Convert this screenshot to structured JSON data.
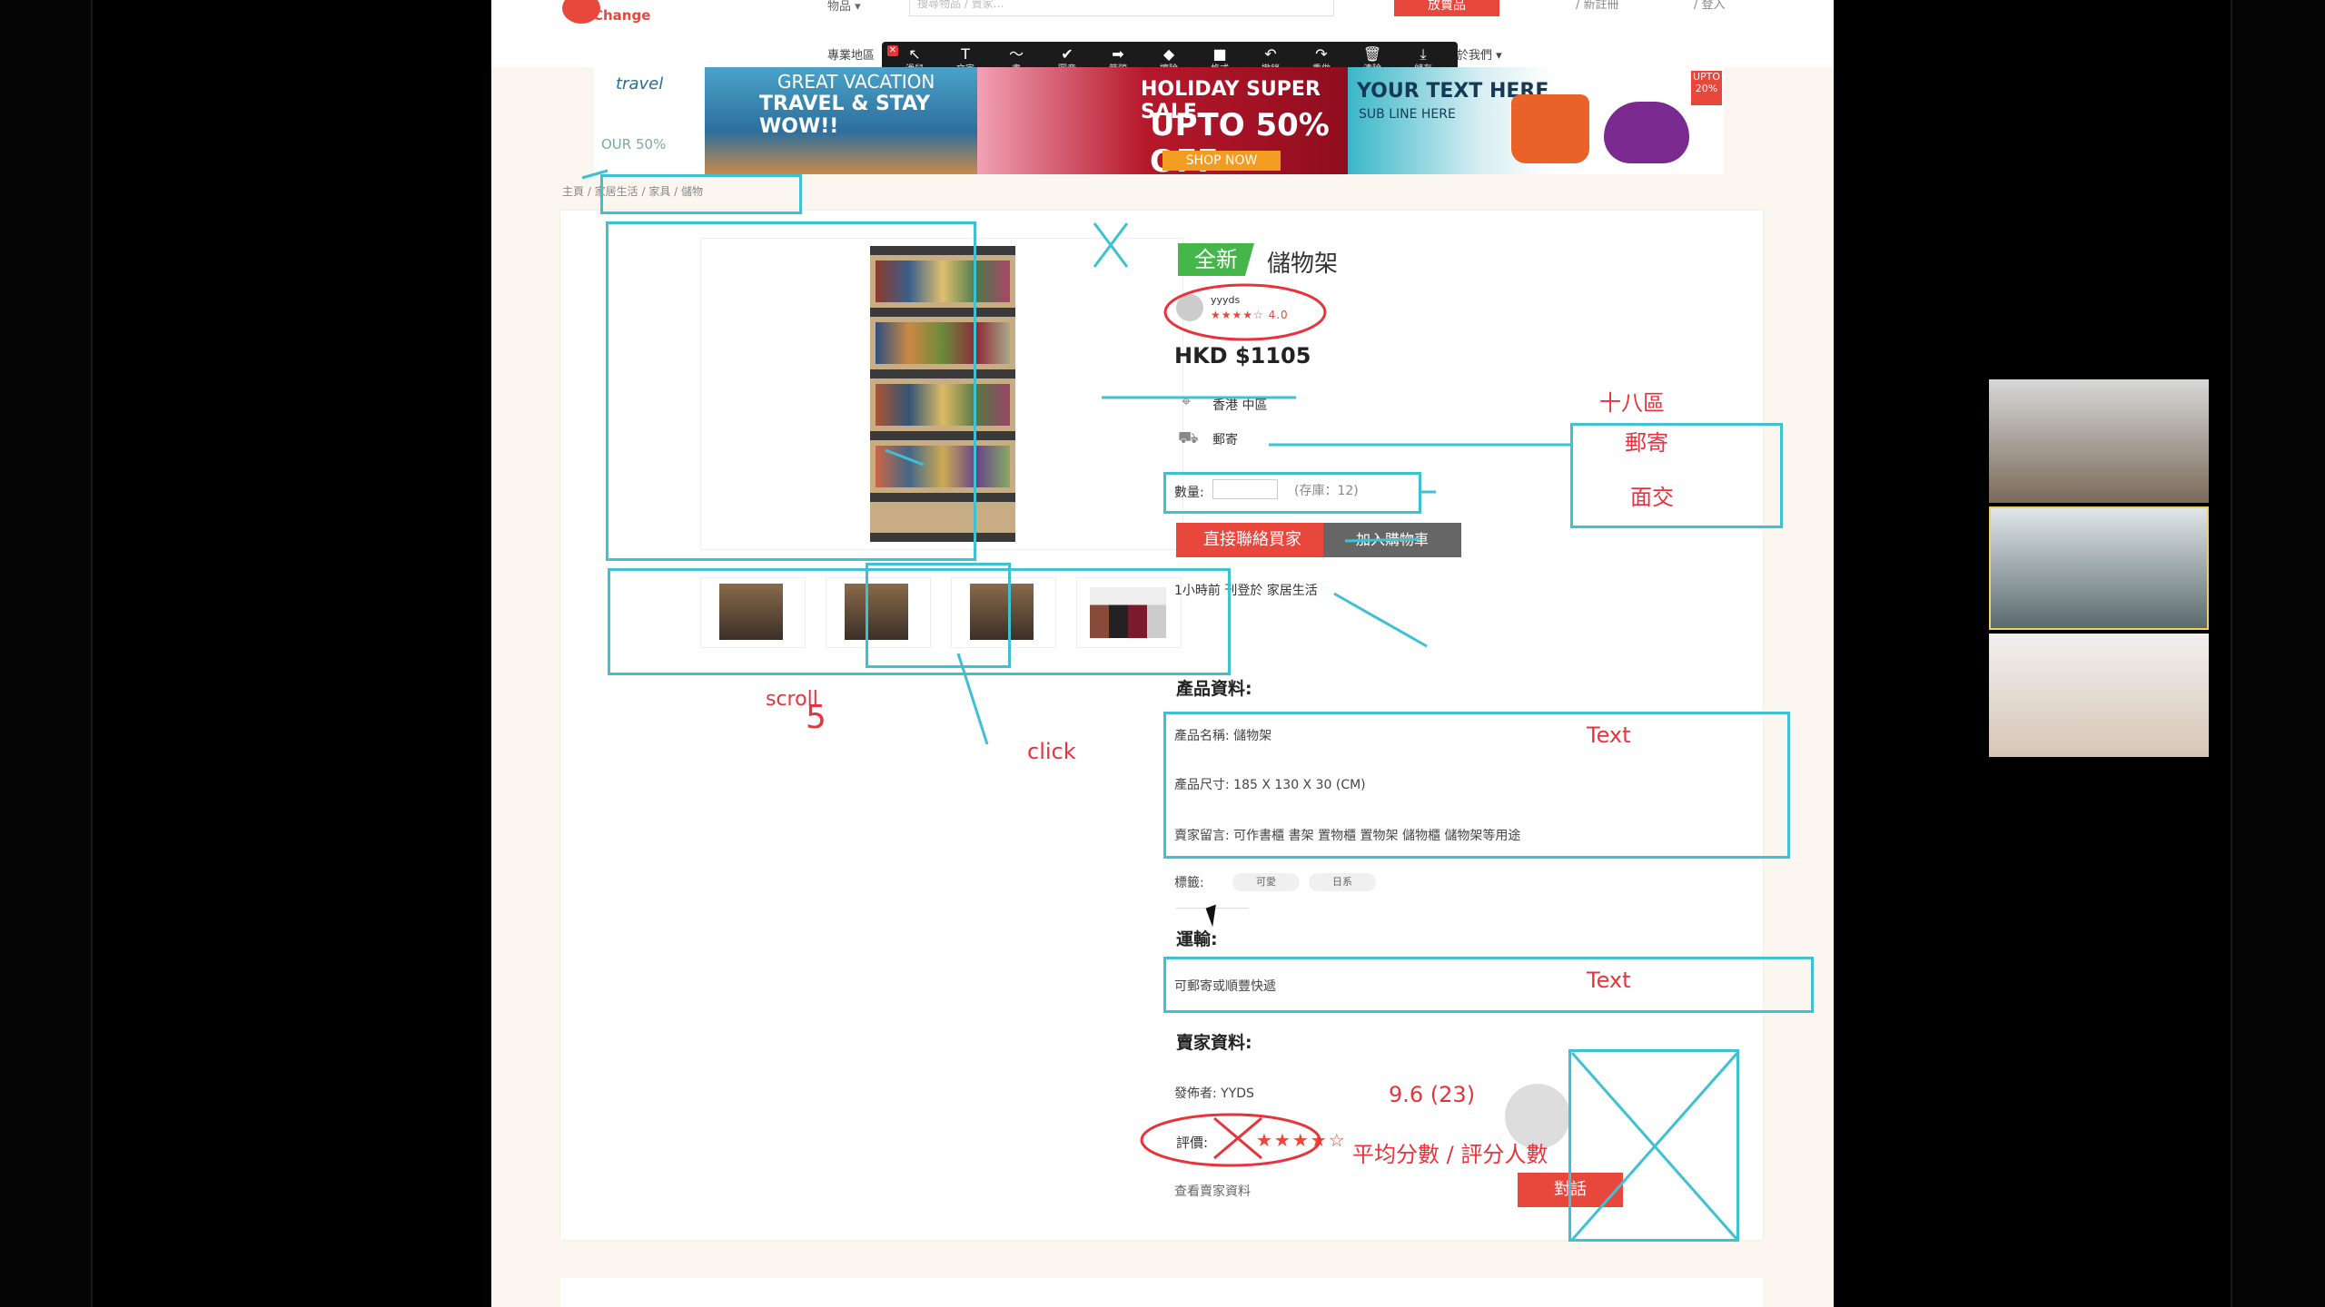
{
  "header": {
    "logo_text": "Change",
    "category_select": "物品 ▾",
    "search_placeholder": "搜尋物品 / 賣家…",
    "post_button": "放賣品",
    "link_1": "/ 新註冊",
    "link_2": "/ 登入"
  },
  "nav": {
    "left_item": "專業地區",
    "right_item": "關於我們 ▾"
  },
  "toolbar": {
    "items": [
      {
        "glyph": "↖",
        "label": "滑鼠"
      },
      {
        "glyph": "T",
        "label": "文字"
      },
      {
        "glyph": "〜",
        "label": "畫"
      },
      {
        "glyph": "✔",
        "label": "圖章"
      },
      {
        "glyph": "➡",
        "label": "箭頭"
      },
      {
        "glyph": "◆",
        "label": "擦除"
      },
      {
        "glyph": "■",
        "label": "格式"
      },
      {
        "glyph": "↶",
        "label": "撤銷"
      },
      {
        "glyph": "↷",
        "label": "重做"
      },
      {
        "glyph": "🗑",
        "label": "清除"
      },
      {
        "glyph": "⤓",
        "label": "儲存"
      }
    ]
  },
  "banner": {
    "b1_logo": "travel",
    "b1_cap": "OUR 50%",
    "b2_line1": "GREAT VACATION",
    "b2_line2": "TRAVEL & STAY WOW!!",
    "b3_line1": "HOLIDAY SUPER SALE",
    "b3_line2": "UPTO 50% OFF",
    "b3_button": "SHOP NOW",
    "b4_line1": "YOUR TEXT HERE",
    "b4_line2": "SUB LINE HERE",
    "b4_badge": "UPTO 20%"
  },
  "breadcrumb": "主頁 / 家居生活 / 家具 / 儲物",
  "product": {
    "condition_badge": "全新",
    "title": "儲物架",
    "seller_name": "yyyds",
    "seller_stars": "★★★★☆ 4.0",
    "price": "HKD $1105",
    "location": "香港 中區",
    "delivery": "郵寄",
    "qty_label": "數量:",
    "stock": "(存庫：12)",
    "buy_button": "直接聯絡買家",
    "cart_button": "加入購物車",
    "contact_note": "1小時前 刊登於 家居生活"
  },
  "details": {
    "section_title": "產品資料:",
    "name_row": "產品名稱:  儲物架",
    "size_row": "產品尺寸:  185 X 130 X 30 (CM)",
    "seller_msg_row": "賣家留言:  可作書櫃 書架 置物櫃 置物架 儲物櫃 儲物架等用途",
    "tags_label": "標籤:",
    "tags": [
      "可愛",
      "日系"
    ]
  },
  "shipping": {
    "section_title": "運輸:",
    "text": "可郵寄或順豐快遞"
  },
  "seller": {
    "section_title": "賣家資料:",
    "poster": "發佈者:  YYDS",
    "rating_label": "評價:",
    "rating_stars": "★★★★☆",
    "view_link": "查看賣家資料",
    "chat_button": "對話"
  },
  "annotations": {
    "district": "十八區",
    "mail": "郵寄",
    "face": "面交",
    "scroll": "scroll",
    "scroll_num": "5",
    "click": "click",
    "text_1": "Text",
    "text_2": "Text",
    "score": "9.6 (23)",
    "score_note": "平均分數 / 評分人數"
  },
  "colors": {
    "accent": "#e8473c",
    "annotation_cyan": "#3ec1d3",
    "annotation_red": "#e8333c",
    "new_badge": "#45b649"
  }
}
